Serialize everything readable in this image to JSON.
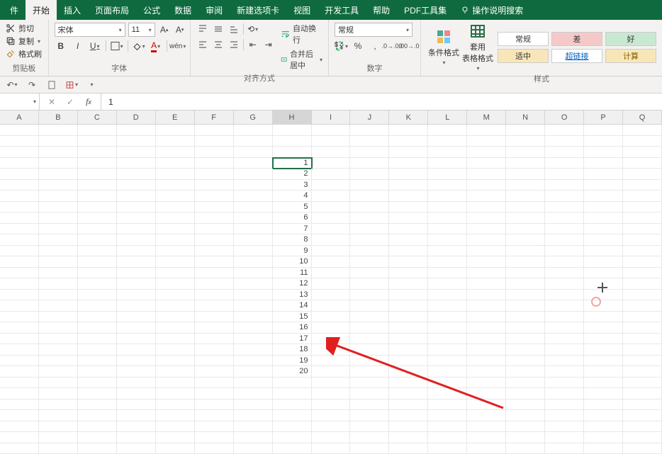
{
  "tabs": {
    "file": "件",
    "home": "开始",
    "insert": "插入",
    "layout": "页面布局",
    "formula": "公式",
    "data": "数据",
    "review": "审阅",
    "newtab": "新建选项卡",
    "view": "视图",
    "dev": "开发工具",
    "help": "帮助",
    "pdf": "PDF工具集",
    "tellme": "操作说明搜索"
  },
  "clipboard": {
    "cut": "剪切",
    "copy": "复制",
    "paint": "格式刷",
    "group": "剪贴板"
  },
  "font": {
    "name": "宋体",
    "size": "11",
    "group": "字体"
  },
  "align": {
    "wrap": "自动换行",
    "merge": "合并后居中",
    "group": "对齐方式"
  },
  "number": {
    "format": "常规",
    "group": "数字"
  },
  "styles": {
    "cond": "条件格式",
    "table": "套用\n表格格式",
    "normal": "常规",
    "bad": "差",
    "good": "好",
    "medium": "适中",
    "link": "超链接",
    "calc": "计算",
    "group": "样式"
  },
  "formula_bar": {
    "name": "",
    "value": "1"
  },
  "columns": [
    "A",
    "B",
    "C",
    "D",
    "E",
    "F",
    "G",
    "H",
    "I",
    "J",
    "K",
    "L",
    "M",
    "N",
    "O",
    "P",
    "Q"
  ],
  "selected_col": "H",
  "cell_data": {
    "col": "H",
    "start_row_index": 3,
    "values": [
      1,
      2,
      3,
      4,
      5,
      6,
      7,
      8,
      9,
      10,
      11,
      12,
      13,
      14,
      15,
      16,
      17,
      18,
      19,
      20
    ]
  },
  "chart_data": {
    "type": "table",
    "note": "Single column of integers 1–20 in column H starting at visual row 4",
    "values": [
      1,
      2,
      3,
      4,
      5,
      6,
      7,
      8,
      9,
      10,
      11,
      12,
      13,
      14,
      15,
      16,
      17,
      18,
      19,
      20
    ]
  }
}
